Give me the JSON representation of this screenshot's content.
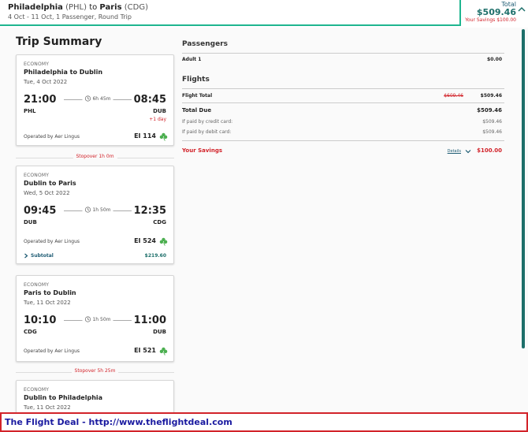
{
  "header": {
    "origin_city": "Philadelphia",
    "origin_code": "(PHL)",
    "to_word": "to",
    "dest_city": "Paris",
    "dest_code": "(CDG)",
    "subtitle": "4 Oct - 11 Oct, 1 Passenger, Round Trip",
    "total_label": "Total",
    "total_amount": "$509.46",
    "savings_text": "Your Savings $100.00"
  },
  "summary": {
    "title": "Trip Summary",
    "flights": [
      {
        "class": "ECONOMY",
        "title": "Philadelphia to Dublin",
        "date": "Tue, 4 Oct 2022",
        "dep_time": "21:00",
        "arr_time": "08:45",
        "duration": "6h 45m",
        "dep_code": "PHL",
        "arr_code": "DUB",
        "day_offset": "+1 day",
        "operator": "Operated by Aer Lingus",
        "flight_no": "EI 114"
      },
      {
        "class": "ECONOMY",
        "title": "Dublin to Paris",
        "date": "Wed, 5 Oct 2022",
        "dep_time": "09:45",
        "arr_time": "12:35",
        "duration": "1h 50m",
        "dep_code": "DUB",
        "arr_code": "CDG",
        "operator": "Operated by Aer Lingus",
        "flight_no": "EI 524",
        "subtotal_label": "Subtotal",
        "subtotal_amount": "$219.60"
      },
      {
        "class": "ECONOMY",
        "title": "Paris to Dublin",
        "date": "Tue, 11 Oct 2022",
        "dep_time": "10:10",
        "arr_time": "11:00",
        "duration": "1h 50m",
        "dep_code": "CDG",
        "arr_code": "DUB",
        "operator": "Operated by Aer Lingus",
        "flight_no": "EI 521"
      },
      {
        "class": "ECONOMY",
        "title": "Dublin to Philadelphia",
        "date": "Tue, 11 Oct 2022"
      }
    ],
    "stopovers": [
      "Stopover 1h 0m",
      "Stopover 5h 25m"
    ]
  },
  "pricing": {
    "passengers_heading": "Passengers",
    "adult_label": "Adult 1",
    "adult_amount": "$0.00",
    "flights_heading": "Flights",
    "flight_total_label": "Flight Total",
    "flight_total_old": "$609.46",
    "flight_total_amount": "$509.46",
    "total_due_label": "Total Due",
    "total_due_amount": "$509.46",
    "credit_label": "If paid by credit card:",
    "credit_amount": "$509.46",
    "debit_label": "If paid by debit card:",
    "debit_amount": "$509.46",
    "savings_label": "Your Savings",
    "details_link": "Details",
    "savings_amount": "$100.00"
  },
  "footer": {
    "text": "The Flight Deal - http://www.theflightdeal.com"
  },
  "colors": {
    "accent_green": "#1fb58f",
    "teal_text": "#1d6f6a",
    "savings_red": "#d2232a",
    "footer_blue": "#1a1aa0"
  },
  "icons": [
    "chevron-up-icon",
    "clock-icon",
    "shamrock-icon",
    "chevron-right-icon",
    "chevron-down-icon"
  ]
}
